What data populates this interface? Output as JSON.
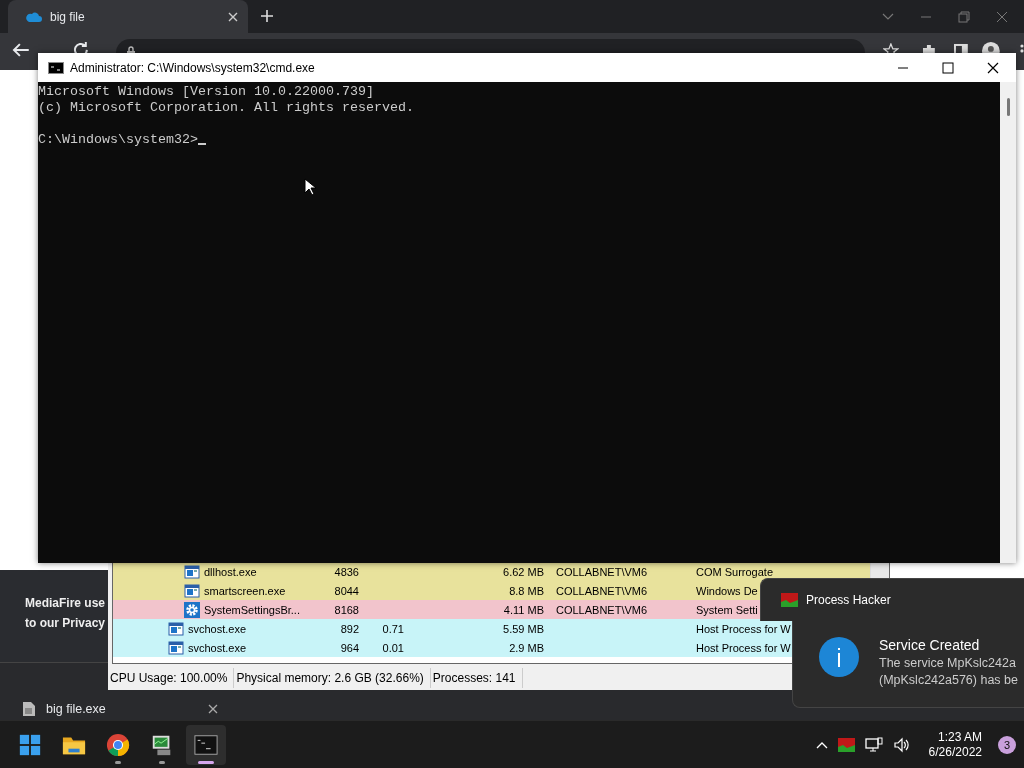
{
  "browser": {
    "tabs": [
      {
        "title": "big file",
        "selected": true
      }
    ],
    "cookie_banner": [
      "MediaFire use",
      "to our Privacy"
    ],
    "downloads": [
      {
        "file": "big file.exe"
      }
    ]
  },
  "console_window": {
    "title": "Administrator: C:\\Windows\\system32\\cmd.exe",
    "output": [
      "Microsoft Windows [Version 10.0.22000.739]",
      "(c) Microsoft Corporation. All rights reserved."
    ],
    "prompt": "C:\\Windows\\system32>"
  },
  "process_hacker": {
    "nested_rows": [
      {
        "kind": "window",
        "color": "#e8e29c",
        "column_1": "dllhost.exe",
        "column_2": "4836",
        "column_4": "6.62 MB",
        "column_5": "COLLABNET\\VM6",
        "column_6": "COM Surrogate"
      },
      {
        "kind": "window",
        "color": "#e8e29c",
        "column_1": "smartscreen.exe",
        "column_2": "8044",
        "column_4": "8.8 MB",
        "column_5": "COLLABNET\\VM6",
        "column_6": "Windows De"
      },
      {
        "kind": "gear",
        "color": "#f2c4cc",
        "column_1": "SystemSettingsBr...",
        "column_2": "8168",
        "column_4": "4.11 MB",
        "column_5": "COLLABNET\\VM6",
        "column_6": "System Setti"
      }
    ],
    "rows": [
      {
        "kind": "window",
        "color": "#c8f4f8",
        "column_1": "svchost.exe",
        "column_2": "892",
        "column_3": "0.71",
        "column_4": "5.59 MB",
        "column_6": "Host Process for W"
      },
      {
        "kind": "window",
        "color": "#c8f4f8",
        "column_1": "svchost.exe",
        "column_2": "964",
        "column_3": "0.01",
        "column_4": "2.9 MB",
        "column_6": "Host Process for W"
      }
    ],
    "status_bar": [
      "CPU Usage: 100.00%",
      "Physical memory: 2.6 GB (32.66%)",
      "Processes: 141"
    ]
  },
  "notification": {
    "app": "Process Hacker",
    "title": "Service Created",
    "body": [
      "The service MpKslc242a",
      "(MpKslc242a576) has be"
    ]
  },
  "taskbar": {
    "apps": [
      {
        "kind": "start",
        "running": false,
        "selected": false
      },
      {
        "kind": "explorer",
        "running": false,
        "selected": false
      },
      {
        "kind": "chrome",
        "running": true,
        "selected": false
      },
      {
        "kind": "process-hacker",
        "running": true,
        "selected": false
      },
      {
        "kind": "terminal",
        "running": true,
        "selected": true
      }
    ],
    "time": "1:23 AM",
    "date": "6/26/2022",
    "notification_count": "3"
  }
}
